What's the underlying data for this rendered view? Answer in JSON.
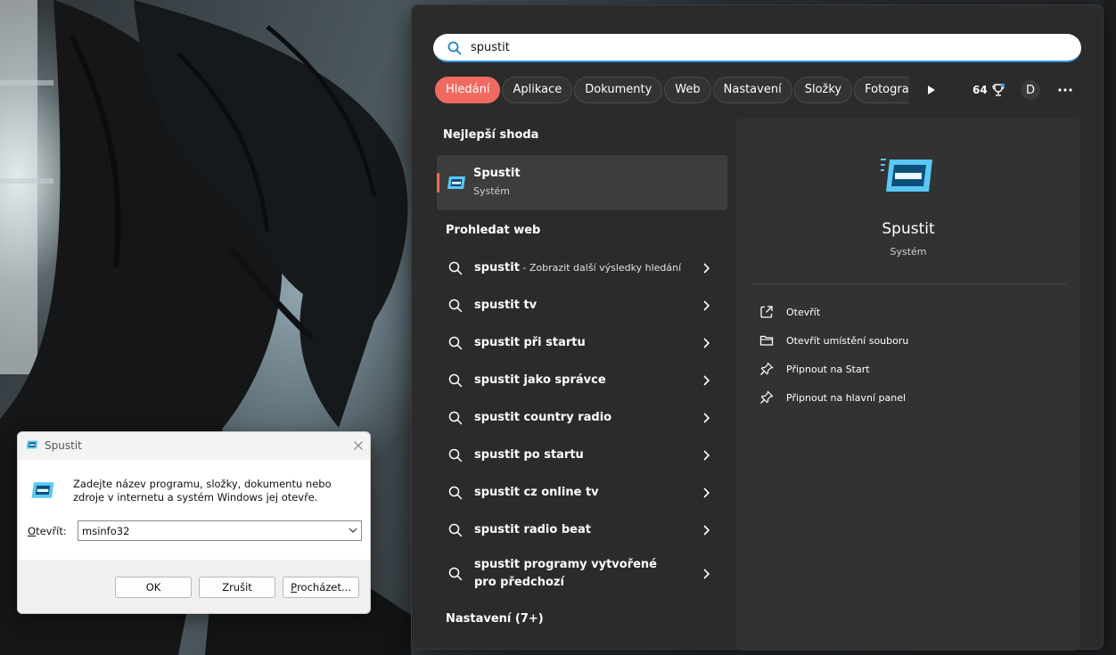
{
  "search": {
    "query": "spustit",
    "filters": [
      "Hledání",
      "Aplikace",
      "Dokumenty",
      "Web",
      "Nastavení",
      "Složky",
      "Fotogra"
    ],
    "points": "64",
    "account_initial": "D",
    "accent_color": "#f06a62"
  },
  "best_match": {
    "heading": "Nejlepší shoda",
    "title": "Spustit",
    "subtitle": "Systém"
  },
  "web": {
    "heading": "Prohledat web",
    "items": [
      {
        "text": "spustit",
        "hint": " - Zobrazit další výsledky hledání"
      },
      {
        "text": "spustit tv",
        "hint": ""
      },
      {
        "text": "spustit při startu",
        "hint": ""
      },
      {
        "text": "spustit jako správce",
        "hint": ""
      },
      {
        "text": "spustit country radio",
        "hint": ""
      },
      {
        "text": "spustit po startu",
        "hint": ""
      },
      {
        "text": "spustit cz online tv",
        "hint": ""
      },
      {
        "text": "spustit radio beat",
        "hint": ""
      },
      {
        "text": "spustit programy vytvořené pro předchozí",
        "hint": ""
      }
    ]
  },
  "settings_heading": "Nastavení (7+)",
  "preview": {
    "title": "Spustit",
    "subtitle": "Systém",
    "actions": [
      {
        "label": "Otevřít",
        "icon": "open-external-icon"
      },
      {
        "label": "Otevřít umístění souboru",
        "icon": "folder-icon"
      },
      {
        "label": "Připnout na Start",
        "icon": "pin-icon"
      },
      {
        "label": "Připnout na hlavní panel",
        "icon": "pin-icon"
      }
    ]
  },
  "run_dialog": {
    "title": "Spustit",
    "description": "Zadejte název programu, složky, dokumentu nebo zdroje v internetu a systém Windows jej otevře.",
    "open_label_accel": "O",
    "open_label_rest": "tevřít:",
    "value": "msinfo32",
    "ok_label": "OK",
    "cancel_label": "Zrušit",
    "browse_label_accel": "P",
    "browse_label_rest": "rocházet..."
  }
}
